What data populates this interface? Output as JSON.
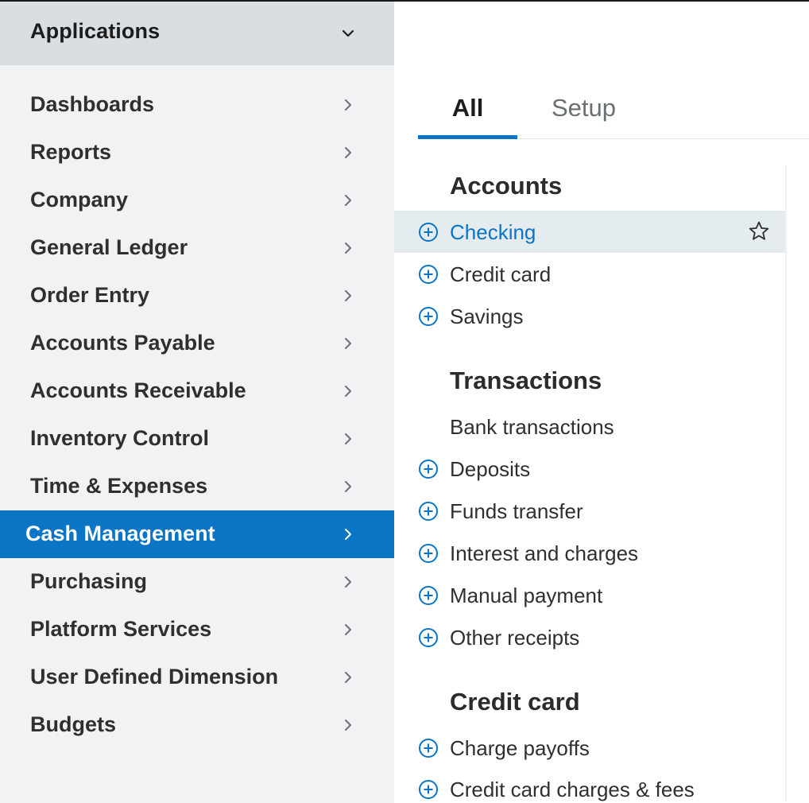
{
  "sidebar": {
    "header": {
      "title": "Applications",
      "icon": "chevron-down-icon"
    },
    "items": [
      {
        "label": "Dashboards"
      },
      {
        "label": "Reports"
      },
      {
        "label": "Company"
      },
      {
        "label": "General Ledger"
      },
      {
        "label": "Order Entry"
      },
      {
        "label": "Accounts Payable"
      },
      {
        "label": "Accounts Receivable"
      },
      {
        "label": "Inventory Control"
      },
      {
        "label": "Time & Expenses"
      },
      {
        "label": "Cash Management",
        "active": true
      },
      {
        "label": "Purchasing"
      },
      {
        "label": "Platform Services"
      },
      {
        "label": "User Defined Dimension"
      },
      {
        "label": "Budgets"
      }
    ]
  },
  "panel": {
    "tabs": [
      {
        "label": "All",
        "selected": true
      },
      {
        "label": "Setup",
        "selected": false
      }
    ],
    "sections": [
      {
        "title": "Accounts",
        "items": [
          {
            "label": "Checking",
            "add": true,
            "highlighted": true,
            "star": true
          },
          {
            "label": "Credit card",
            "add": true
          },
          {
            "label": "Savings",
            "add": true
          }
        ]
      },
      {
        "title": "Transactions",
        "items": [
          {
            "label": "Bank transactions",
            "add": false
          },
          {
            "label": "Deposits",
            "add": true
          },
          {
            "label": "Funds transfer",
            "add": true
          },
          {
            "label": "Interest and charges",
            "add": true
          },
          {
            "label": "Manual payment",
            "add": true
          },
          {
            "label": "Other receipts",
            "add": true
          }
        ]
      },
      {
        "title": "Credit card",
        "items": [
          {
            "label": "Charge payoffs",
            "add": true
          },
          {
            "label": "Credit card charges & fees",
            "add": true
          }
        ]
      }
    ]
  },
  "colors": {
    "accent": "#0a75c4",
    "sidebar_bg": "#f0f2f4",
    "header_bg": "#d9dee2",
    "highlight_bg": "#e4ecef"
  }
}
